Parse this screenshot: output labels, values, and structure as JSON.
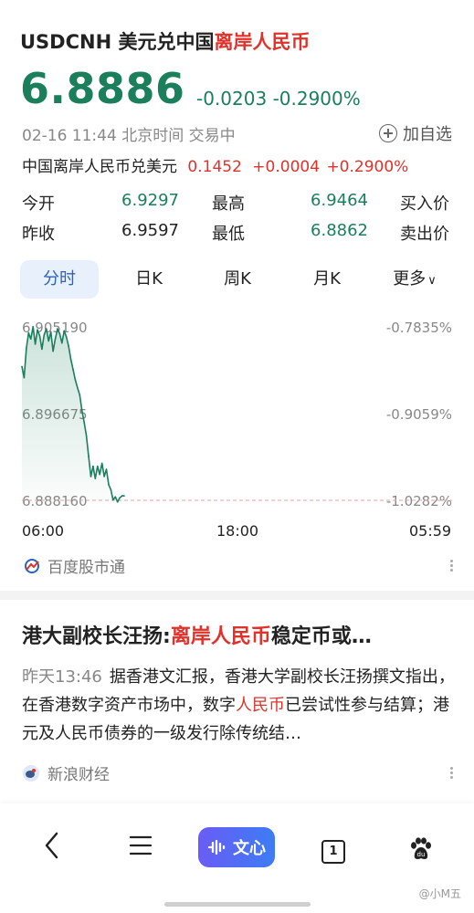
{
  "header": {
    "title_prefix": "USDCNH 美元兑中国",
    "title_highlight": "离岸人民币",
    "price": "6.8886",
    "change": "-0.0203",
    "change_pct": "-0.2900%",
    "datetime": "02-16 11:44",
    "timezone": "北京时间",
    "trading_status": "交易中",
    "add_watchlist": "加自选"
  },
  "cross_rate": {
    "label": "中国离岸人民币兑美元",
    "value": "0.1452",
    "change": "+0.0004",
    "change_pct": "+0.2900%"
  },
  "stats": {
    "open_label": "今开",
    "open_value": "6.9297",
    "high_label": "最高",
    "high_value": "6.9464",
    "buy_label": "买入价",
    "prev_close_label": "昨收",
    "prev_close_value": "6.9597",
    "low_label": "最低",
    "low_value": "6.8862",
    "sell_label": "卖出价"
  },
  "tabs": [
    "分时",
    "日K",
    "周K",
    "月K",
    "更多"
  ],
  "chart_data": {
    "type": "line",
    "y_ticks_left": [
      "6.905190",
      "6.896675",
      "6.888160"
    ],
    "y_ticks_right": [
      "-0.7835%",
      "-0.9059%",
      "-1.0282%"
    ],
    "x_ticks": [
      "06:00",
      "18:00",
      "05:59"
    ],
    "ylim": [
      6.88816,
      6.90519
    ],
    "series": [
      {
        "color": "#1a7f5a",
        "x": [
          0,
          1,
          2,
          3,
          4,
          5,
          6,
          7,
          8,
          9,
          10,
          11,
          12,
          13,
          14,
          15,
          16,
          17,
          18,
          19,
          20,
          21,
          22,
          23,
          24,
          25,
          26,
          27,
          28,
          29,
          30,
          31,
          32,
          33,
          34,
          35,
          36,
          37,
          38,
          39,
          40,
          41,
          42,
          43,
          44,
          45,
          46
        ],
        "values": [
          6.9013,
          6.9002,
          6.9031,
          6.9046,
          6.904,
          6.9052,
          6.9035,
          6.9049,
          6.9043,
          6.903,
          6.9044,
          6.905,
          6.9038,
          6.9047,
          6.9028,
          6.904,
          6.905,
          6.9045,
          6.9036,
          6.9048,
          6.9042,
          6.9033,
          6.902,
          6.901,
          6.9,
          6.8992,
          6.8985,
          6.897,
          6.8958,
          6.8945,
          6.8925,
          6.8905,
          6.8915,
          6.8903,
          6.8915,
          6.8907,
          6.8918,
          6.8905,
          6.8912,
          6.8897,
          6.8892,
          6.8882,
          6.8885,
          6.888,
          6.8884,
          6.8886,
          6.8886
        ]
      }
    ],
    "baseline": 6.88816,
    "grid": false
  },
  "source1": "百度股市通",
  "news": {
    "title_prefix": "港大副校长汪扬:",
    "title_highlight": "离岸人民币",
    "title_suffix": "稳定币或…",
    "time": "昨天13:46",
    "body_part1": "据香港文汇报，香港大学副校长汪扬撰文指出，在香港数字资产市场中，数字",
    "body_highlight": "人民币",
    "body_part2": "已尝试性参与结算；港元及人民币债券的一级发行除传统结…",
    "source": "新浪财经"
  },
  "bottom_nav": {
    "wenxin_label": "文心",
    "tab_count": "1"
  },
  "watermark": "@小M五"
}
